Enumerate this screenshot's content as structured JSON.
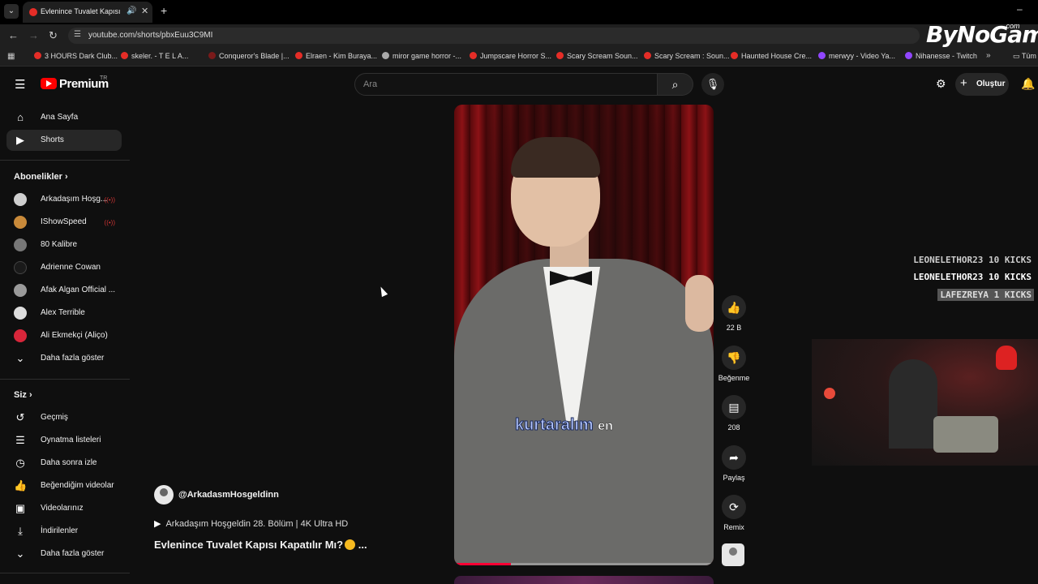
{
  "browser": {
    "tab_title": "Evlenince Tuvalet Kapısı Ka...",
    "url": "youtube.com/shorts/pbxEuu3C9MI",
    "bookmarks": [
      "3 HOURS Dark Club...",
      "skeler. - T E L A...",
      "Conqueror's Blade |...",
      "Elraen - Kim Buraya...",
      "miror game horror -...",
      "Jumpscare Horror S...",
      "Scary Scream Soun...",
      "Scary Scream : Soun...",
      "Haunted House Cre...",
      "merwyy - Video Ya...",
      "Nihanesse - Twitch"
    ],
    "bookmark_folder": "Tüm"
  },
  "watermark": {
    "text": "ByNoGame",
    "suffix": ".com"
  },
  "header": {
    "logo_text": "Premium",
    "logo_region": "TR",
    "search_placeholder": "Ara",
    "create_label": "Oluştur"
  },
  "sidebar": {
    "main": [
      {
        "label": "Ana Sayfa",
        "icon": "home-icon"
      },
      {
        "label": "Shorts",
        "icon": "shorts-icon",
        "active": true
      }
    ],
    "subscriptions_heading": "Abonelikler",
    "subscriptions": [
      {
        "label": "Arkadaşım Hoşg...",
        "live": true,
        "color": "#cfcfcf"
      },
      {
        "label": "IShowSpeed",
        "live": true,
        "color": "#c98a3a"
      },
      {
        "label": "80 Kalibre",
        "live": false,
        "color": "#777777"
      },
      {
        "label": "Adrienne Cowan",
        "live": false,
        "color": "#1a1a1a"
      },
      {
        "label": "Afak Algan Official ...",
        "live": false,
        "color": "#9a9a9a"
      },
      {
        "label": "Alex Terrible",
        "live": false,
        "color": "#dddddd"
      },
      {
        "label": "Ali Ekmekçi (Aliço)",
        "live": false,
        "color": "#d8263a"
      }
    ],
    "show_more_1": "Daha fazla göster",
    "you_heading": "Siz",
    "you_items": [
      {
        "label": "Geçmiş",
        "icon": "history-icon"
      },
      {
        "label": "Oynatma listeleri",
        "icon": "playlist-icon"
      },
      {
        "label": "Daha sonra izle",
        "icon": "clock-icon"
      },
      {
        "label": "Beğendiğim videolar",
        "icon": "thumbs-up-icon"
      },
      {
        "label": "Videolarınız",
        "icon": "video-icon"
      },
      {
        "label": "İndirilenler",
        "icon": "download-icon"
      }
    ],
    "show_more_2": "Daha fazla göster"
  },
  "short": {
    "channel": "@ArkadasmHosgeldinn",
    "linked_video": "Arkadaşım Hoşgeldin 28. Bölüm | 4K Ultra HD",
    "title": "Evlenince Tuvalet Kapısı Kapatılır Mı?",
    "title_more": "...",
    "caption_word1": "kurtaralım",
    "caption_word2": "en",
    "progress": 0.22
  },
  "actions": {
    "like_count": "22 B",
    "dislike_label": "Beğenme",
    "comment_count": "208",
    "share_label": "Paylaş",
    "remix_label": "Remix"
  },
  "overlay": {
    "kicks": [
      "LEONELETHOR23  10 KICKS",
      "LEONELETHOR23  10 KICKS",
      "LAFEZREYA  1 KICKS"
    ]
  }
}
